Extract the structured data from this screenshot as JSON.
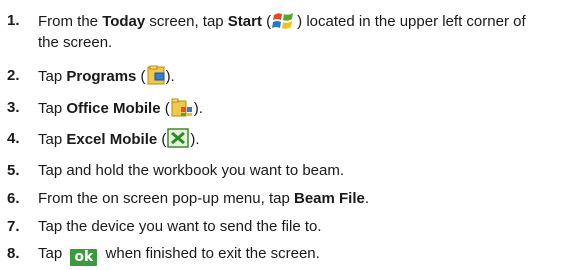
{
  "steps": [
    {
      "num": "1.",
      "pre": "From the ",
      "b1": "Today",
      "mid": " screen, tap ",
      "b2": "Start",
      "post_open": " (",
      "post_close": ") located in the upper left corner of",
      "line2": "the screen."
    },
    {
      "num": "2.",
      "pre": "Tap ",
      "b1": "Programs",
      "post_open": " (",
      "post_close": ")."
    },
    {
      "num": "3.",
      "pre": "Tap ",
      "b1": "Office Mobile",
      "post_open": " (",
      "post_close": ")."
    },
    {
      "num": "4.",
      "pre": "Tap ",
      "b1": "Excel Mobile",
      "post_open": " (",
      "post_close": ")."
    },
    {
      "num": "5.",
      "text": "Tap and hold the workbook you want to beam."
    },
    {
      "num": "6.",
      "pre": "From the on screen pop-up menu, tap ",
      "b1": "Beam File",
      "post": "."
    },
    {
      "num": "7.",
      "text": "Tap the device you want to send the file to."
    },
    {
      "num": "8.",
      "pre": "Tap ",
      "button": "ok",
      "post": " when finished to exit the screen."
    }
  ],
  "icons": {
    "start": "windows-start-icon",
    "programs": "programs-folder-icon",
    "office": "office-mobile-icon",
    "excel": "excel-mobile-icon"
  },
  "colors": {
    "ok_button": "#3c9b3e",
    "text": "#1a1a1a"
  }
}
